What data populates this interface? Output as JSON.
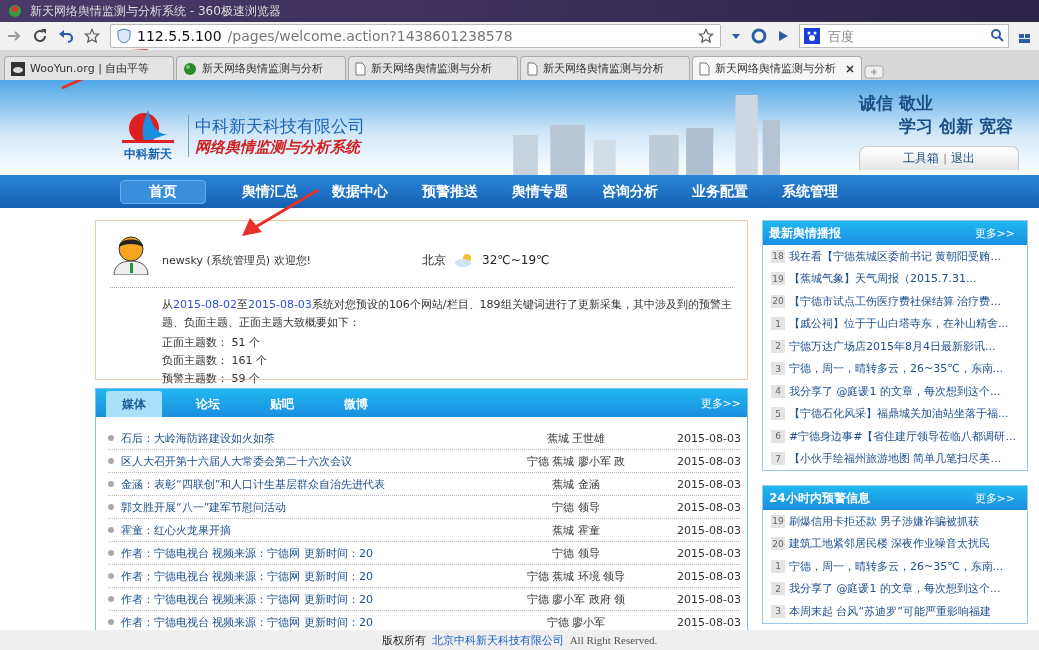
{
  "window": {
    "title": "新天网络舆情监测与分析系统 - 360极速浏览器"
  },
  "address_bar": {
    "host": "112.5.5.100",
    "path": "/pages/welcome.action?1438601238578"
  },
  "search": {
    "placeholder": "百度"
  },
  "tabs": [
    {
      "label": "WooYun.org | 自由平等",
      "selected": false,
      "kind": "cloud"
    },
    {
      "label": "新天网络舆情监测与分析",
      "selected": false,
      "kind": "globe"
    },
    {
      "label": "新天网络舆情监测与分析",
      "selected": false,
      "kind": "page"
    },
    {
      "label": "新天网络舆情监测与分析",
      "selected": false,
      "kind": "page"
    },
    {
      "label": "新天网络舆情监测与分析",
      "selected": true,
      "kind": "page"
    }
  ],
  "header": {
    "logo_caption": "中科新天",
    "company": "中科新天科技有限公司",
    "system": "网络舆情监测与分析系统",
    "slogan_1": "诚信 敬业",
    "slogan_2": "学习 创新 宽容",
    "tools": [
      "工具箱",
      "退出"
    ],
    "tool_separator": "|"
  },
  "nav": [
    {
      "label": "首页",
      "selected": true
    },
    {
      "label": "舆情汇总",
      "selected": false
    },
    {
      "label": "数据中心",
      "selected": false
    },
    {
      "label": "预警推送",
      "selected": false
    },
    {
      "label": "舆情专题",
      "selected": false
    },
    {
      "label": "咨询分析",
      "selected": false
    },
    {
      "label": "业务配置",
      "selected": false
    },
    {
      "label": "系统管理",
      "selected": false
    }
  ],
  "welcome": {
    "user": "newsky (系统管理员) 欢迎您!",
    "city": "北京",
    "temperature": "32℃~19℃",
    "summary": [
      "从",
      "2015-08-02",
      "至",
      "2015-08-03",
      "系统对您预设的106个网站/栏目、189组关键词进行了更新采集，其中涉及到的预警主题、负面主题、正面主题大致概要如下："
    ],
    "stats": [
      {
        "label": "正面主题数：",
        "value": "51 个"
      },
      {
        "label": "负面主题数：",
        "value": "161 个"
      },
      {
        "label": "预警主题数：",
        "value": "59 个"
      }
    ]
  },
  "media": {
    "tabs": [
      {
        "label": "媒体",
        "selected": true
      },
      {
        "label": "论坛",
        "selected": false
      },
      {
        "label": "贴吧",
        "selected": false
      },
      {
        "label": "微博",
        "selected": false
      }
    ],
    "more": "更多>>",
    "rows": [
      {
        "title": "石后：大岭海防路建设如火如荼",
        "tags": "蕉城 王世雄",
        "date": "2015-08-03"
      },
      {
        "title": "区人大召开第十六届人大常委会第二十六次会议",
        "tags": "宁德 蕉城 廖小军 政",
        "date": "2015-08-03"
      },
      {
        "title": "金涵：表彰“四联创”和人口计生基层群众自治先进代表",
        "tags": "蕉城 金涵",
        "date": "2015-08-03"
      },
      {
        "title": "郭文胜开展“八一”建军节慰问活动",
        "tags": "宁德 领导",
        "date": "2015-08-03"
      },
      {
        "title": "霍童：红心火龙果开摘",
        "tags": "蕉城 霍童",
        "date": "2015-08-03"
      },
      {
        "title": "作者：宁德电视台 视频来源：宁德网 更新时间：20",
        "tags": "宁德 领导",
        "date": "2015-08-03"
      },
      {
        "title": "作者：宁德电视台 视频来源：宁德网 更新时间：20",
        "tags": "宁德 蕉城 环境 领导",
        "date": "2015-08-03"
      },
      {
        "title": "作者：宁德电视台 视频来源：宁德网 更新时间：20",
        "tags": "宁德 廖小军 政府 领",
        "date": "2015-08-03"
      },
      {
        "title": "作者：宁德电视台 视频来源：宁德网 更新时间：20",
        "tags": "宁德 廖小军",
        "date": "2015-08-03"
      }
    ]
  },
  "panels": [
    {
      "title": "最新舆情播报",
      "more": "更多>>",
      "items": [
        {
          "num": "18",
          "text": "我在看【宁德蕉城区委前书记 黄朝阳受贿..."
        },
        {
          "num": "19",
          "text": "【蕉城气象】天气周报（2015.7.31..."
        },
        {
          "num": "20",
          "text": "【宁德市试点工伤医疗费社保结算 治疗费..."
        },
        {
          "num": "1",
          "text": "【戚公祠】位于于山白塔寺东，在补山精舍..."
        },
        {
          "num": "2",
          "text": "宁德万达广场店2015年8月4日最新影讯..."
        },
        {
          "num": "3",
          "text": "宁德，周一，晴转多云，26~35℃，东南..."
        },
        {
          "num": "4",
          "text": "我分享了 @庭谖1 的文章，每次想到这个..."
        },
        {
          "num": "5",
          "text": "【宁德石化风采】福鼎城关加油站坐落于福..."
        },
        {
          "num": "6",
          "text": "#宁德身边事#【省住建厅领导莅临八都调研..."
        },
        {
          "num": "7",
          "text": "【小伙手绘福州旅游地图 简单几笔扫尽美..."
        }
      ]
    },
    {
      "title": "24小时内预警信息",
      "more": "更多>>",
      "items": [
        {
          "num": "19",
          "text": "刷爆信用卡拒还款 男子涉嫌诈骗被抓获"
        },
        {
          "num": "20",
          "text": "建筑工地紧邻居民楼 深夜作业噪音太扰民"
        },
        {
          "num": "1",
          "text": "宁德，周一，晴转多云，26~35℃，东南..."
        },
        {
          "num": "2",
          "text": "我分享了 @庭谖1 的文章，每次想到这个..."
        },
        {
          "num": "3",
          "text": "本周末起 台风“苏迪罗”可能严重影响福建"
        }
      ]
    }
  ],
  "footer": {
    "prefix": "版权所有",
    "company": "北京中科新天科技有限公司",
    "suffix": "All Right Reserved."
  }
}
